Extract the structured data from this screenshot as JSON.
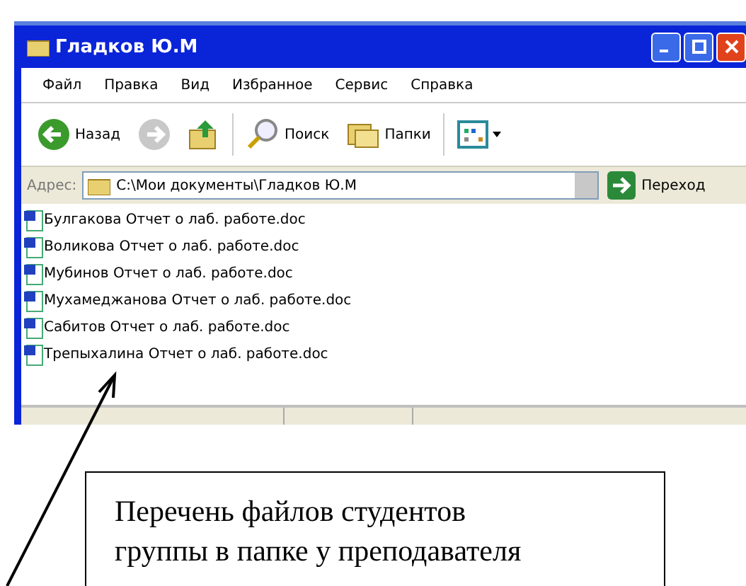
{
  "window": {
    "title": "Гладков Ю.М"
  },
  "menu": [
    "Файл",
    "Правка",
    "Вид",
    "Избранное",
    "Сервис",
    "Справка"
  ],
  "toolbar": [
    {
      "kind": "back",
      "label": "Назад",
      "disabled": false
    },
    {
      "kind": "forward",
      "disabled": true
    },
    {
      "kind": "up",
      "disabled": false
    },
    {
      "kind": "search",
      "label": "Поиск",
      "disabled": false
    },
    {
      "kind": "folders",
      "label": "Папки",
      "disabled": false
    },
    {
      "kind": "views",
      "disabled": false
    }
  ],
  "address": {
    "label": "Адрес:",
    "value": "C:\\Мои документы\\Гладков Ю.М",
    "go": "Переход"
  },
  "files": [
    "Булгакова Отчет о лаб. работе.doc",
    "Воликова Отчет о лаб. работе.doc",
    "Мубинов Отчет о лаб. работе.doc",
    "Мухамеджанова Отчет о лаб. работе.doc",
    "Сабитов Отчет о лаб. работе.doc",
    "Трепыхалина Отчет о лаб. работе.doc"
  ],
  "callout": {
    "text": "Перечень файлов студентов\nгруппы в папке у преподавателя"
  }
}
